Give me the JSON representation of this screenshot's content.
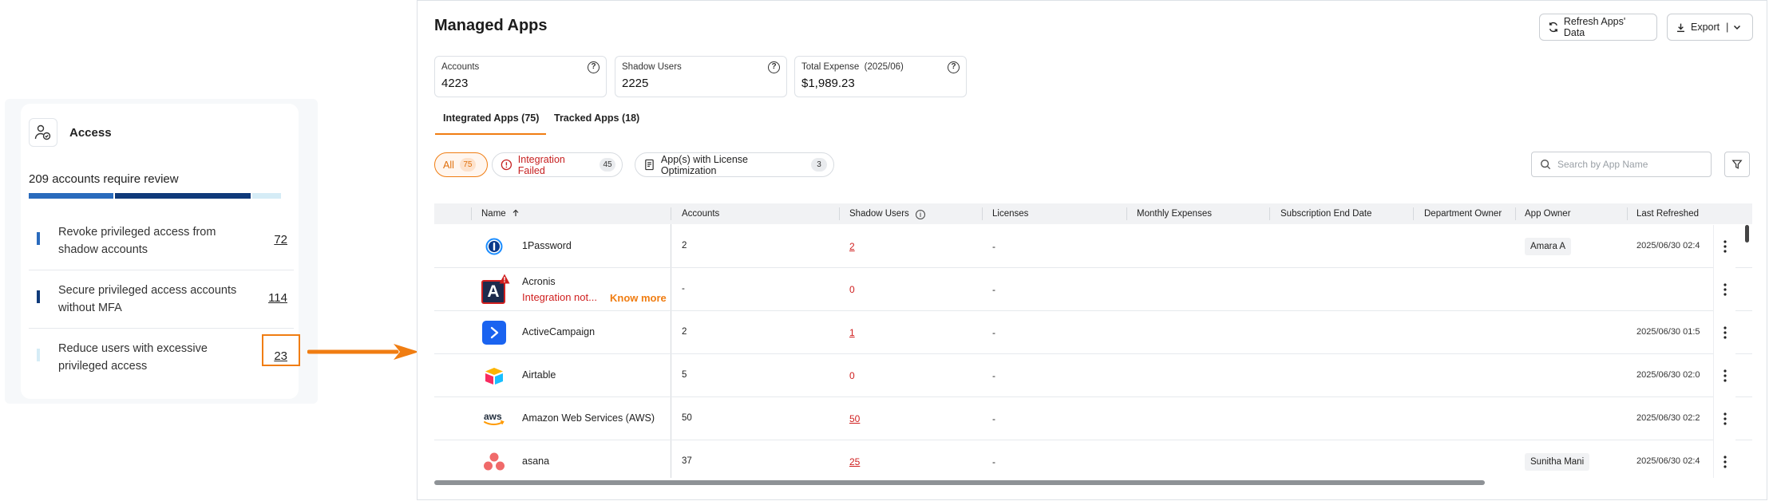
{
  "access": {
    "title": "Access",
    "summary": "209 accounts require review",
    "items": [
      {
        "label": "Revoke privileged access from shadow accounts",
        "count": "72",
        "color": "#2a6bbd"
      },
      {
        "label": "Secure privileged access accounts without MFA",
        "count": "114",
        "color": "#0f3a7a"
      },
      {
        "label": "Reduce users with excessive privileged access",
        "count": "23",
        "color": "#d5ecf6"
      }
    ],
    "progress_fractions": [
      0.32,
      0.51,
      0.11
    ]
  },
  "header": {
    "title": "Managed Apps",
    "refresh_label": "Refresh Apps' Data",
    "export_label": "Export"
  },
  "stats": {
    "accounts": {
      "label": "Accounts",
      "value": "4223"
    },
    "shadow": {
      "label": "Shadow Users",
      "value": "2225"
    },
    "expense": {
      "label": "Total Expense  (2025/06)",
      "value": "$1,989.23"
    }
  },
  "tabs": {
    "integrated": "Integrated Apps (75)",
    "tracked": "Tracked Apps (18)"
  },
  "filters": {
    "all": {
      "label": "All",
      "count": "75"
    },
    "failed": {
      "label": "Integration Failed",
      "count": "45"
    },
    "license": {
      "label": "App(s) with License Optimization",
      "count": "3"
    }
  },
  "search": {
    "placeholder": "Search by App Name"
  },
  "table": {
    "columns": {
      "name": "Name",
      "accounts": "Accounts",
      "shadow": "Shadow Users",
      "licenses": "Licenses",
      "expenses": "Monthly Expenses",
      "subscription": "Subscription End Date",
      "dept_owner": "Department Owner",
      "app_owner": "App Owner",
      "refreshed": "Last Refreshed"
    },
    "rows": [
      {
        "name": "1Password",
        "accounts": "2",
        "shadow": "2",
        "licenses": "-",
        "app_owner": "Amara A",
        "refreshed": "2025/06/30 02:4",
        "logo": "1password-icon"
      },
      {
        "name": "Acronis",
        "status": "Integration not...",
        "know_more": "Know more",
        "accounts": "-",
        "shadow": "0",
        "licenses": "-",
        "app_owner": "",
        "refreshed": "",
        "logo": "acronis-icon"
      },
      {
        "name": "ActiveCampaign",
        "accounts": "2",
        "shadow": "1",
        "licenses": "-",
        "app_owner": "",
        "refreshed": "2025/06/30 01:5",
        "logo": "activecampaign-icon"
      },
      {
        "name": "Airtable",
        "accounts": "5",
        "shadow": "0",
        "licenses": "-",
        "app_owner": "",
        "refreshed": "2025/06/30 02:0",
        "logo": "airtable-icon"
      },
      {
        "name": "Amazon Web Services (AWS)",
        "accounts": "50",
        "shadow": "50",
        "licenses": "-",
        "app_owner": "",
        "refreshed": "2025/06/30 02:2",
        "logo": "aws-icon"
      },
      {
        "name": "asana",
        "accounts": "37",
        "shadow": "25",
        "licenses": "-",
        "app_owner": "Sunitha Mani",
        "refreshed": "2025/06/30 02:4",
        "logo": "asana-icon"
      }
    ]
  },
  "colors": {
    "accent": "#f07d12",
    "error": "#d02020"
  }
}
